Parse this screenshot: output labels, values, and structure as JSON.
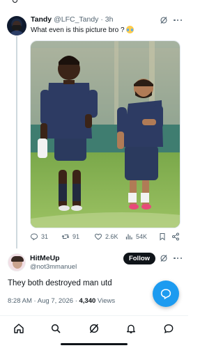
{
  "tweet": {
    "display_name": "Tandy",
    "handle": "@LFC_Tandy",
    "separator": "·",
    "time_ago": "3h",
    "text": "What even is this picture bro ?",
    "emoji": "loudly-crying-face"
  },
  "actions": {
    "replies": "31",
    "reposts": "91",
    "likes": "2.6K",
    "views": "54K"
  },
  "reply": {
    "display_name": "HitMeUp",
    "handle": "@not3mmanuel",
    "follow_label": "Follow",
    "text": "They both destroyed man utd",
    "time": "8:28 AM",
    "separator1": "·",
    "date": "Aug 7, 2026",
    "separator2": "·",
    "views_count": "4,340",
    "views_label": "Views"
  },
  "colors": {
    "accent": "#1d9bf0",
    "text_primary": "#0f1419",
    "text_secondary": "#536471",
    "follow_bg": "#0f1419"
  },
  "nav": [
    "home-icon",
    "search-icon",
    "grok-icon",
    "notifications-icon",
    "messages-icon"
  ]
}
